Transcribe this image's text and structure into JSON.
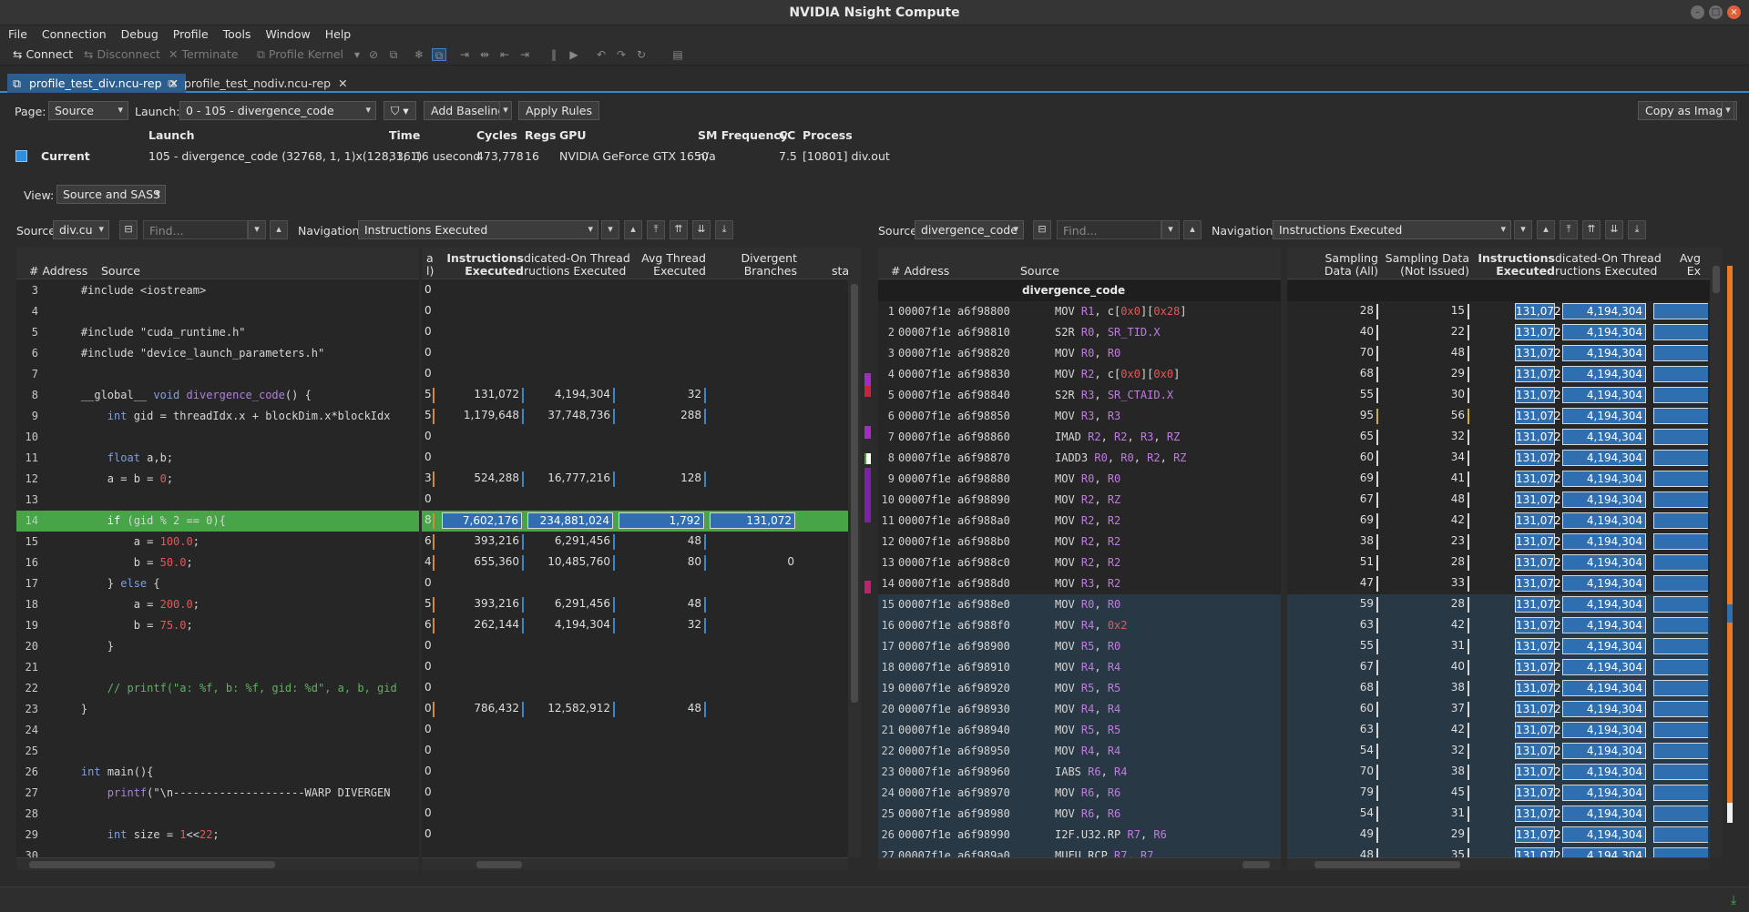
{
  "window": {
    "title": "NVIDIA Nsight Compute"
  },
  "menu": [
    "File",
    "Connection",
    "Debug",
    "Profile",
    "Tools",
    "Window",
    "Help"
  ],
  "toolbar": {
    "connect": "Connect",
    "disconnect": "Disconnect",
    "terminate": "Terminate",
    "profile_kernel": "Profile Kernel"
  },
  "tabs": [
    {
      "label": "profile_test_div.ncu-rep"
    },
    {
      "label": "profile_test_nodiv.ncu-rep"
    }
  ],
  "controls": {
    "page_label": "Page:",
    "page_value": "Source",
    "launch_label": "Launch:",
    "launch_value": "0 -  105 - divergence_code",
    "add_baseline": "Add Baseline",
    "apply_rules": "Apply Rules",
    "copy_as_image": "Copy as Image",
    "view_label": "View:",
    "view_value": "Source and SASS"
  },
  "launch_info": {
    "headers": {
      "launch": "Launch",
      "time": "Time",
      "cycles": "Cycles",
      "regs": "Regs",
      "gpu": "GPU",
      "sm_freq": "SM Frequency",
      "cc": "CC",
      "process": "Process"
    },
    "current_label": "Current",
    "values": {
      "launch": "105 - divergence_code (32768, 1, 1)x(128, 1, 1)",
      "time": "336.16 usecond",
      "cycles": "473,778",
      "regs": "16",
      "gpu": "NVIDIA GeForce GTX 1650",
      "sm_freq": "n/a",
      "cc": "7.5",
      "process": "[10801] div.out"
    },
    "current_color": "#2f8fdc"
  },
  "left": {
    "source_label": "Source:",
    "source_value": "div.cu",
    "find_placeholder": "Find...",
    "nav_label": "Navigation:",
    "nav_value": "Instructions Executed",
    "headers": {
      "address": "# Address",
      "source": "Source",
      "a": "a",
      "a2": "l)",
      "ie1": "Instructions",
      "ie2": "Executed",
      "pt1": "dicated-On Thread",
      "pt2": "ructions Executed",
      "at1": "Avg Thread",
      "at2": "Executed",
      "db1": "Divergent",
      "db2": "Branches",
      "sta": "sta"
    },
    "lines": [
      {
        "n": "3",
        "code": "    #include <iostream>",
        "a": "0"
      },
      {
        "n": "4",
        "code": "",
        "a": "0"
      },
      {
        "n": "5",
        "code": "    #include \"cuda_runtime.h\"",
        "a": "0"
      },
      {
        "n": "6",
        "code": "    #include \"device_launch_parameters.h\"",
        "a": "0"
      },
      {
        "n": "7",
        "code": "",
        "a": "0"
      },
      {
        "n": "8",
        "code": "    __global__ void divergence_code() {",
        "a": "5",
        "ie": "131,072",
        "pt": "4,194,304",
        "at": "32"
      },
      {
        "n": "9",
        "code": "        int gid = threadIdx.x + blockDim.x*blockIdx",
        "a": "5",
        "ie": "1,179,648",
        "pt": "37,748,736",
        "at": "288"
      },
      {
        "n": "10",
        "code": "",
        "a": "0"
      },
      {
        "n": "11",
        "code": "        float a,b;",
        "a": "0"
      },
      {
        "n": "12",
        "code": "        a = b = 0;",
        "a": "3",
        "ie": "524,288",
        "pt": "16,777,216",
        "at": "128"
      },
      {
        "n": "13",
        "code": "",
        "a": "0"
      },
      {
        "n": "14",
        "code": "        if (gid % 2 == 0){",
        "a": "8",
        "ie": "7,602,176",
        "pt": "234,881,024",
        "at": "1,792",
        "db": "131,072"
      },
      {
        "n": "15",
        "code": "            a = 100.0;",
        "a": "6",
        "ie": "393,216",
        "pt": "6,291,456",
        "at": "48"
      },
      {
        "n": "16",
        "code": "            b = 50.0;",
        "a": "4",
        "ie": "655,360",
        "pt": "10,485,760",
        "at": "80",
        "db": "0"
      },
      {
        "n": "17",
        "code": "        } else {",
        "a": "0"
      },
      {
        "n": "18",
        "code": "            a = 200.0;",
        "a": "5",
        "ie": "393,216",
        "pt": "6,291,456",
        "at": "48"
      },
      {
        "n": "19",
        "code": "            b = 75.0;",
        "a": "6",
        "ie": "262,144",
        "pt": "4,194,304",
        "at": "32"
      },
      {
        "n": "20",
        "code": "        }",
        "a": "0"
      },
      {
        "n": "21",
        "code": "",
        "a": "0"
      },
      {
        "n": "22",
        "code": "        // printf(\"a: %f, b: %f, gid: %d\", a, b, gid",
        "a": "0"
      },
      {
        "n": "23",
        "code": "    }",
        "a": "0",
        "ie": "786,432",
        "pt": "12,582,912",
        "at": "48"
      },
      {
        "n": "24",
        "code": "",
        "a": "0"
      },
      {
        "n": "25",
        "code": "",
        "a": "0"
      },
      {
        "n": "26",
        "code": "    int main(){",
        "a": "0"
      },
      {
        "n": "27",
        "code": "        printf(\"\\n--------------------WARP DIVERGEN",
        "a": "0"
      },
      {
        "n": "28",
        "code": "",
        "a": "0"
      },
      {
        "n": "29",
        "code": "        int size = 1<<22;",
        "a": "0"
      },
      {
        "n": "30",
        "code": "",
        "a": ""
      }
    ]
  },
  "right": {
    "source_label": "Source:",
    "source_value": "divergence_code",
    "find_placeholder": "Find...",
    "nav_label": "Navigation:",
    "nav_value": "Instructions Executed",
    "headers": {
      "address": "# Address",
      "source": "Source",
      "sd1": "Sampling",
      "sd2": "Data (All)",
      "sn1": "Sampling Data",
      "sn2": "(Not Issued)",
      "ie1": "Instructions",
      "ie2": "Executed",
      "pt1": "dicated-On Thread",
      "pt2": "ructions Executed",
      "avg1": "Avg",
      "avg2": "Ex"
    },
    "function_name": "divergence_code",
    "instr_value": "131,072",
    "thread_value": "4,194,304",
    "rows": [
      {
        "n": "1",
        "addr": "00007f1e a6f98800",
        "op": "MOV",
        "args": "R1, c[0x0][0x28]",
        "sd": "28",
        "sn": "15"
      },
      {
        "n": "2",
        "addr": "00007f1e a6f98810",
        "op": "S2R",
        "args": "R0, SR_TID.X",
        "sd": "40",
        "sn": "22"
      },
      {
        "n": "3",
        "addr": "00007f1e a6f98820",
        "op": "MOV",
        "args": "R0, R0",
        "sd": "70",
        "sn": "48"
      },
      {
        "n": "4",
        "addr": "00007f1e a6f98830",
        "op": "MOV",
        "args": "R2, c[0x0][0x0]",
        "sd": "68",
        "sn": "29"
      },
      {
        "n": "5",
        "addr": "00007f1e a6f98840",
        "op": "S2R",
        "args": "R3, SR_CTAID.X",
        "sd": "55",
        "sn": "30"
      },
      {
        "n": "6",
        "addr": "00007f1e a6f98850",
        "op": "MOV",
        "args": "R3, R3",
        "sd": "95",
        "sn": "56"
      },
      {
        "n": "7",
        "addr": "00007f1e a6f98860",
        "op": "IMAD",
        "args": "R2, R2, R3, RZ",
        "sd": "65",
        "sn": "32"
      },
      {
        "n": "8",
        "addr": "00007f1e a6f98870",
        "op": "IADD3",
        "args": "R0, R0, R2, RZ",
        "sd": "60",
        "sn": "34"
      },
      {
        "n": "9",
        "addr": "00007f1e a6f98880",
        "op": "MOV",
        "args": "R0, R0",
        "sd": "69",
        "sn": "41"
      },
      {
        "n": "10",
        "addr": "00007f1e a6f98890",
        "op": "MOV",
        "args": "R2, RZ",
        "sd": "67",
        "sn": "48"
      },
      {
        "n": "11",
        "addr": "00007f1e a6f988a0",
        "op": "MOV",
        "args": "R2, R2",
        "sd": "69",
        "sn": "42"
      },
      {
        "n": "12",
        "addr": "00007f1e a6f988b0",
        "op": "MOV",
        "args": "R2, R2",
        "sd": "38",
        "sn": "23"
      },
      {
        "n": "13",
        "addr": "00007f1e a6f988c0",
        "op": "MOV",
        "args": "R2, R2",
        "sd": "51",
        "sn": "28"
      },
      {
        "n": "14",
        "addr": "00007f1e a6f988d0",
        "op": "MOV",
        "args": "R3, R2",
        "sd": "47",
        "sn": "33"
      },
      {
        "n": "15",
        "addr": "00007f1e a6f988e0",
        "op": "MOV",
        "args": "R0, R0",
        "sd": "59",
        "sn": "28"
      },
      {
        "n": "16",
        "addr": "00007f1e a6f988f0",
        "op": "MOV",
        "args": "R4, 0x2",
        "sd": "63",
        "sn": "42"
      },
      {
        "n": "17",
        "addr": "00007f1e a6f98900",
        "op": "MOV",
        "args": "R5, R0",
        "sd": "55",
        "sn": "31"
      },
      {
        "n": "18",
        "addr": "00007f1e a6f98910",
        "op": "MOV",
        "args": "R4, R4",
        "sd": "67",
        "sn": "40"
      },
      {
        "n": "19",
        "addr": "00007f1e a6f98920",
        "op": "MOV",
        "args": "R5, R5",
        "sd": "68",
        "sn": "38"
      },
      {
        "n": "20",
        "addr": "00007f1e a6f98930",
        "op": "MOV",
        "args": "R4, R4",
        "sd": "60",
        "sn": "37"
      },
      {
        "n": "21",
        "addr": "00007f1e a6f98940",
        "op": "MOV",
        "args": "R5, R5",
        "sd": "63",
        "sn": "42"
      },
      {
        "n": "22",
        "addr": "00007f1e a6f98950",
        "op": "MOV",
        "args": "R4, R4",
        "sd": "54",
        "sn": "32"
      },
      {
        "n": "23",
        "addr": "00007f1e a6f98960",
        "op": "IABS",
        "args": "R6, R4",
        "sd": "70",
        "sn": "38"
      },
      {
        "n": "24",
        "addr": "00007f1e a6f98970",
        "op": "MOV",
        "args": "R6, R6",
        "sd": "79",
        "sn": "45"
      },
      {
        "n": "25",
        "addr": "00007f1e a6f98980",
        "op": "MOV",
        "args": "R6, R6",
        "sd": "54",
        "sn": "31"
      },
      {
        "n": "26",
        "addr": "00007f1e a6f98990",
        "op": "I2F.U32.RP",
        "args": "R7, R6",
        "sd": "49",
        "sn": "29"
      },
      {
        "n": "27",
        "addr": "00007f1e a6f989a0",
        "op": "MUFU.RCP",
        "args": "R7, R7",
        "sd": "48",
        "sn": "35"
      }
    ]
  },
  "colors": {
    "accent": "#3b86c9",
    "highlight": "#47a447",
    "bar": "#2f6fb0"
  }
}
